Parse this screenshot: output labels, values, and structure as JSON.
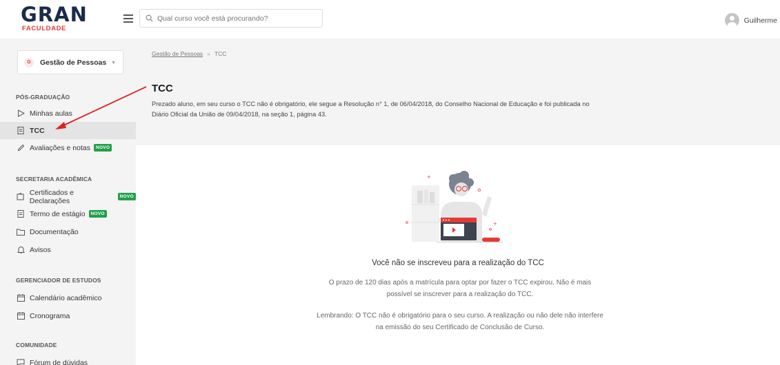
{
  "header": {
    "logo_main": "GRAN",
    "logo_sub": "FACULDADE",
    "search_placeholder": "Qual curso você está procurando?",
    "user_name": "Guilherme"
  },
  "sidebar": {
    "course": {
      "label": "Gestão de Pessoas"
    },
    "sections": [
      {
        "title": "PÓS-GRADUAÇÃO",
        "items": [
          {
            "label": "Minhas aulas",
            "icon": "play-icon"
          },
          {
            "label": "TCC",
            "icon": "document-icon",
            "active": true
          },
          {
            "label": "Avaliações e notas",
            "icon": "pencil-icon",
            "badge": "NOVO"
          }
        ]
      },
      {
        "title": "SECRETARIA ACADÊMICA",
        "items": [
          {
            "label": "Certificados e Declarações",
            "icon": "certificate-icon",
            "badge": "NOVO"
          },
          {
            "label": "Termo de estágio",
            "icon": "document-icon",
            "badge": "NOVO"
          },
          {
            "label": "Documentação",
            "icon": "folder-icon"
          },
          {
            "label": "Avisos",
            "icon": "bell-icon"
          }
        ]
      },
      {
        "title": "GERENCIADOR DE ESTUDOS",
        "items": [
          {
            "label": "Calendário acadêmico",
            "icon": "calendar-icon"
          },
          {
            "label": "Cronograma",
            "icon": "calendar-icon"
          }
        ]
      },
      {
        "title": "COMUNIDADE",
        "items": [
          {
            "label": "Fórum de dúvidas",
            "icon": "chat-icon"
          }
        ]
      }
    ]
  },
  "main": {
    "breadcrumb": {
      "parent": "Gestão de Pessoas",
      "separator": "»",
      "current": "TCC"
    },
    "title": "TCC",
    "description": "Prezado aluno, em seu curso o TCC não é obrigatório, ele segue a Resolução n° 1, de 06/04/2018, do Conselho Nacional de Educação e foi publicada no Diário Oficial da União de 09/04/2018, na seção 1, página 43.",
    "empty_state": {
      "title": "Você não se inscreveu para a realização do TCC",
      "paragraph_1": "O prazo de 120 dias após a matrícula para optar por fazer o TCC expirou. Não é mais possível se inscrever para a realização do TCC.",
      "paragraph_2": "Lembrando: O TCC não é obrigatório para o seu curso. A realização ou não dele não interfere na emissão do seu Certificado de Conclusão de Curso."
    }
  },
  "colors": {
    "accent_red": "#e53935",
    "badge_green": "#21a04a",
    "logo_navy": "#1a2b4c",
    "sidebar_bg": "#f4f4f4"
  }
}
